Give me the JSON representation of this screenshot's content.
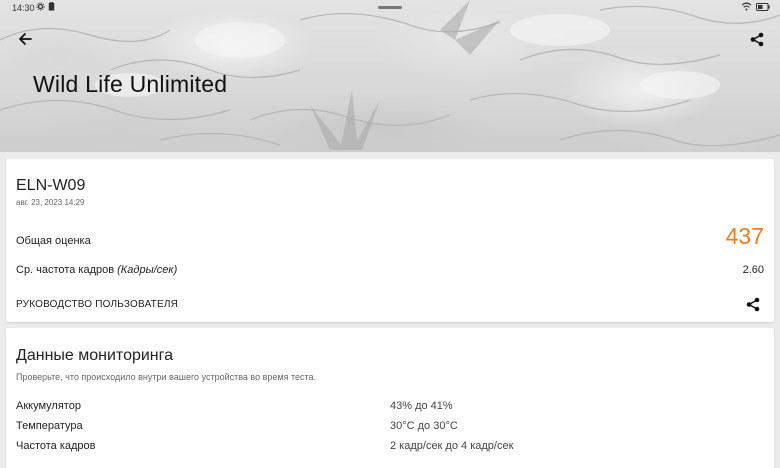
{
  "status_bar": {
    "time": "14:30"
  },
  "header": {
    "title": "Wild Life Unlimited"
  },
  "result": {
    "device": "ELN-W09",
    "date": "авг. 23, 2023 14:29",
    "overall_label": "Общая оценка",
    "overall_value": "437",
    "fps_label": "Ср. частота кадров",
    "fps_unit": "(Кадры/сек)",
    "fps_value": "2.60",
    "guide_label": "РУКОВОДСТВО ПОЛЬЗОВАТЕЛЯ"
  },
  "monitoring": {
    "title": "Данные мониторинга",
    "subtitle": "Проверьте, что происходило внутри вашего устройства во время теста.",
    "rows": [
      {
        "label": "Аккумулятор",
        "value": "43% до 41%"
      },
      {
        "label": "Температура",
        "value": "30°C до 30°C"
      },
      {
        "label": "Частота кадров",
        "value": "2 кадр/сек до 4 кадр/сек"
      }
    ]
  },
  "colors": {
    "accent": "#ef7d22",
    "background": "#ececec",
    "card": "#ffffff"
  },
  "icons": [
    "back-arrow-icon",
    "share-icon",
    "settings-icon",
    "battery-icon",
    "wifi-icon"
  ]
}
